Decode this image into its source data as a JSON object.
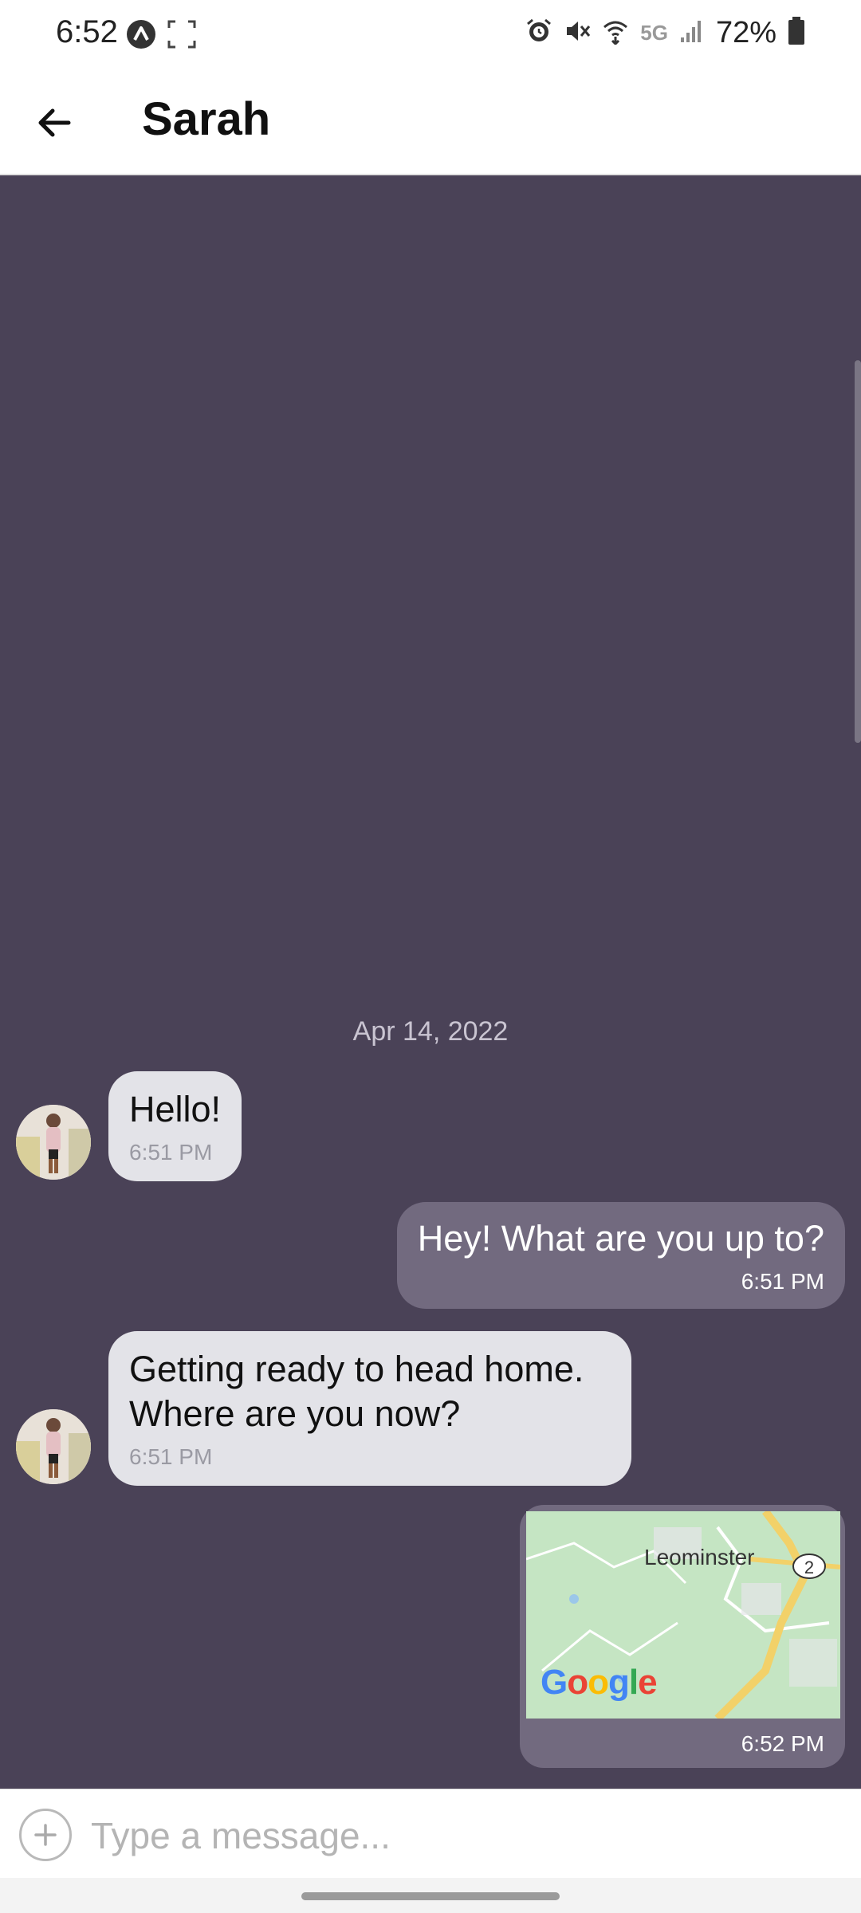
{
  "status_bar": {
    "time": "6:52",
    "network": "5G",
    "battery_percent": "72%",
    "icons": [
      "app-a-icon",
      "screenshot-frame-icon",
      "alarm-icon",
      "mute-icon",
      "wifi-icon",
      "signal-icon",
      "battery-icon"
    ]
  },
  "header": {
    "title": "Sarah",
    "back_icon": "arrow-left-icon"
  },
  "chat": {
    "background": "#4a4257",
    "date_separator": "Apr 14, 2022",
    "messages": [
      {
        "direction": "incoming",
        "text": "Hello!",
        "time": "6:51 PM"
      },
      {
        "direction": "outgoing",
        "text": "Hey! What are you up to?",
        "time": "6:51 PM"
      },
      {
        "direction": "incoming",
        "lines": [
          "Getting ready to head home.",
          "Where are you now?"
        ],
        "time": "6:51 PM"
      },
      {
        "direction": "outgoing",
        "type": "map",
        "map_label": "Leominster",
        "route_badge": "2",
        "map_brand": "Google",
        "time": "6:52 PM"
      }
    ]
  },
  "input": {
    "placeholder": "Type a message...",
    "add_icon": "plus-circle-icon"
  },
  "colors": {
    "incoming_bubble": "#e3e3e8",
    "outgoing_bubble": "#726a7f",
    "chat_background": "#4a4257"
  }
}
